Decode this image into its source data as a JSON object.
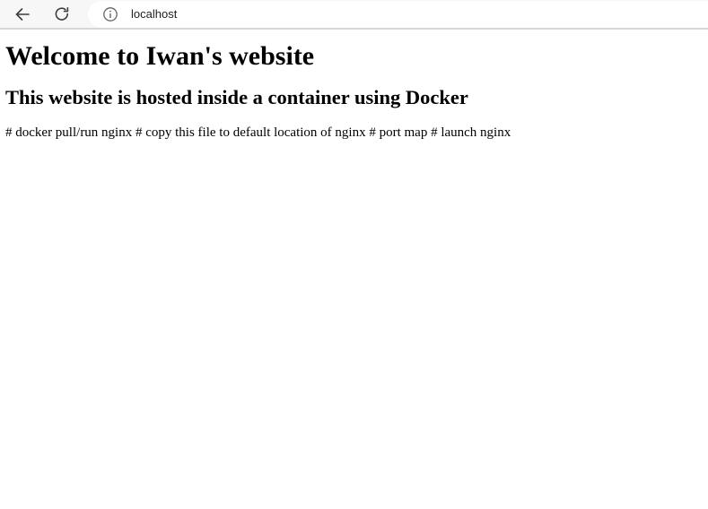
{
  "browser": {
    "url": "localhost",
    "icons": {
      "back": "back-arrow-icon",
      "reload": "reload-icon",
      "site_info": "info-icon"
    }
  },
  "page": {
    "heading": "Welcome to Iwan's website",
    "subheading": "This website is hosted inside a container using Docker",
    "body_text": "# docker pull/run nginx # copy this file to default location of nginx # port map # launch nginx"
  }
}
